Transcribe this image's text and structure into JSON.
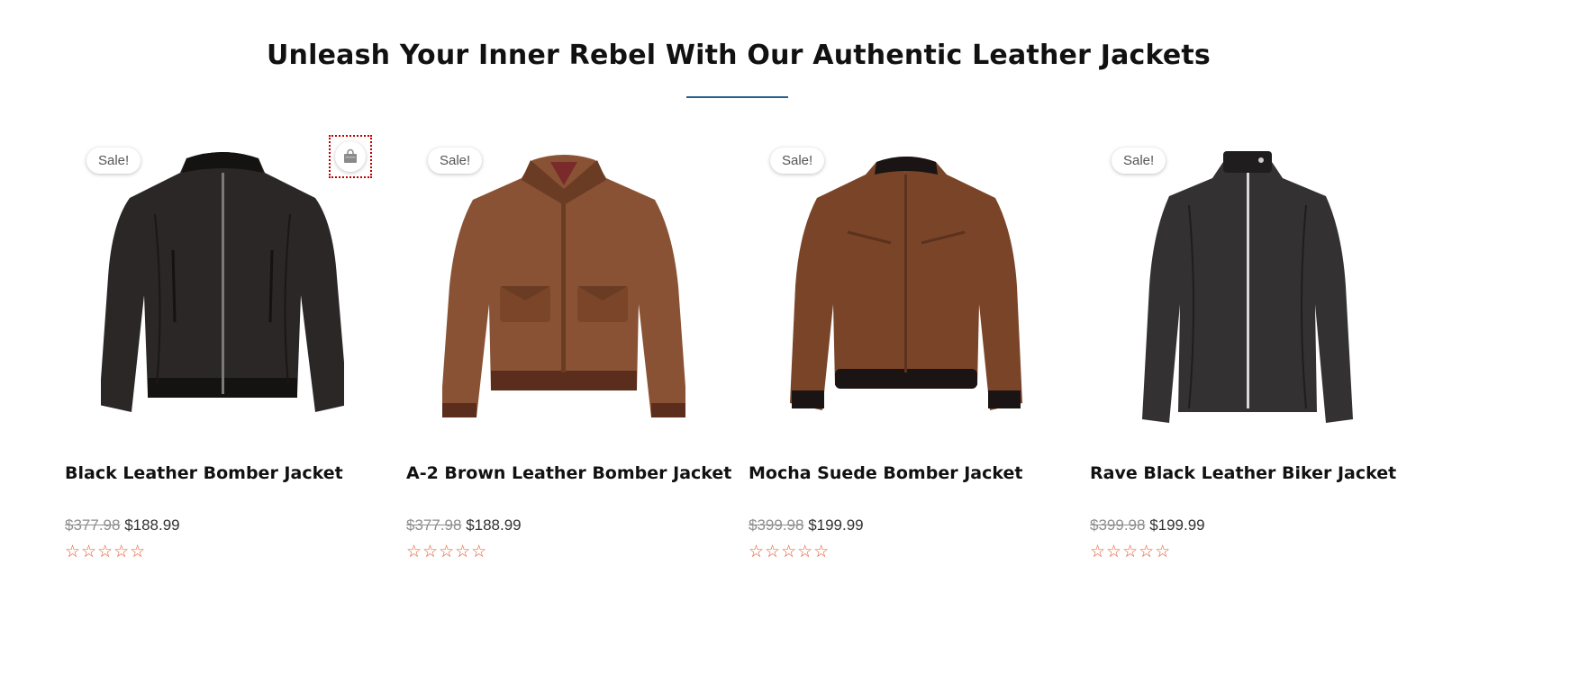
{
  "section": {
    "title": "Unleash Your Inner Rebel With Our Authentic Leather Jackets"
  },
  "products": [
    {
      "name": "Black Leather Bomber Jacket",
      "badge": "Sale!",
      "old_price": "$377.98",
      "new_price": "$188.99",
      "rating_stars": "☆☆☆☆☆",
      "image_icon": "black-bomber-jacket-image",
      "colors": {
        "body": "#2b2727",
        "shade": "#1a1717",
        "rib": "#151212"
      }
    },
    {
      "name": "A-2 Brown Leather Bomber Jacket",
      "badge": "Sale!",
      "old_price": "$377.98",
      "new_price": "$188.99",
      "rating_stars": "☆☆☆☆☆",
      "image_icon": "brown-a2-jacket-image",
      "colors": {
        "body": "#8a5234",
        "shade": "#6b3c24",
        "rib": "#5a2d1c"
      }
    },
    {
      "name": "Mocha Suede Bomber Jacket",
      "badge": "Sale!",
      "old_price": "$399.98",
      "new_price": "$199.99",
      "rating_stars": "☆☆☆☆☆",
      "image_icon": "mocha-suede-jacket-image",
      "colors": {
        "body": "#7a4428",
        "shade": "#5c321d",
        "rib": "#1a1414"
      }
    },
    {
      "name": "Rave Black Leather Biker Jacket",
      "badge": "Sale!",
      "old_price": "$399.98",
      "new_price": "$199.99",
      "rating_stars": "☆☆☆☆☆",
      "image_icon": "black-biker-jacket-image",
      "colors": {
        "body": "#333131",
        "shade": "#1f1d1d",
        "rib": "#2a2828"
      }
    }
  ],
  "icons": {
    "quick_add": "shopping-bag-icon"
  },
  "theme": {
    "divider": "#2a5e8c",
    "star": "#e85a2c",
    "old_price": "#8e8e8e"
  }
}
